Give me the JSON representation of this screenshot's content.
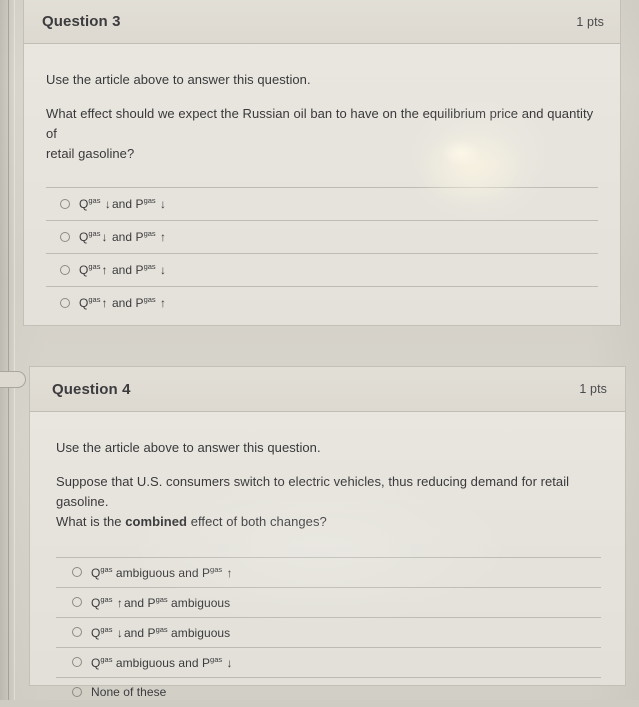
{
  "colors": {
    "page_bg": "#d6d3ca",
    "card_bg": "#e7e5dd",
    "header_bg": "#ddd9d1",
    "card_border": "#c3c0b7",
    "title_text": "#3c3c3f",
    "body_text": "#39393c",
    "divider": "#b0ada4"
  },
  "questions": [
    {
      "title": "Question 3",
      "points": "1 pts",
      "prompt_intro": "Use the article above to answer this question.",
      "prompt_line1": "What effect should we expect the Russian oil ban to have on the equilibrium price and quantity of",
      "prompt_line2": "retail gasoline?",
      "options": [
        {
          "q_symbol": "Q",
          "q_sup": "gas",
          "q_state": "↓",
          "conjunction": "and",
          "p_symbol": "P",
          "p_sup": "gas",
          "p_state": "↓"
        },
        {
          "q_symbol": "Q",
          "q_sup": "gas",
          "q_state": "↓",
          "conjunction": "and",
          "p_symbol": "P",
          "p_sup": "gas",
          "p_state": "↑"
        },
        {
          "q_symbol": "Q",
          "q_sup": "gas",
          "q_state": "↑",
          "conjunction": "and",
          "p_symbol": "P",
          "p_sup": "gas",
          "p_state": "↓"
        },
        {
          "q_symbol": "Q",
          "q_sup": "gas",
          "q_state": "↑",
          "conjunction": "and",
          "p_symbol": "P",
          "p_sup": "gas",
          "p_state": "↑"
        }
      ]
    },
    {
      "title": "Question 4",
      "points": "1 pts",
      "prompt_intro": "Use the article above to answer this question.",
      "prompt_line1_a": "Suppose that U.S. consumers switch to electric vehicles, thus reducing demand for retail gasoline.",
      "prompt_line2_a": "What is the ",
      "prompt_line2_bold": "combined",
      "prompt_line2_b": " effect of both changes?",
      "options": [
        {
          "q_symbol": "Q",
          "q_sup": "gas",
          "q_state": "ambiguous",
          "conjunction": "and",
          "p_symbol": "P",
          "p_sup": "gas",
          "p_state": "↑"
        },
        {
          "q_symbol": "Q",
          "q_sup": "gas",
          "q_state": "↑",
          "conjunction": "and",
          "p_symbol": "P",
          "p_sup": "gas",
          "p_state": "ambiguous"
        },
        {
          "q_symbol": "Q",
          "q_sup": "gas",
          "q_state": "↓",
          "conjunction": "and",
          "p_symbol": "P",
          "p_sup": "gas",
          "p_state": "ambiguous"
        },
        {
          "q_symbol": "Q",
          "q_sup": "gas",
          "q_state": "ambiguous",
          "conjunction": "and",
          "p_symbol": "P",
          "p_sup": "gas",
          "p_state": "↓"
        },
        {
          "plain": "None of these"
        }
      ]
    }
  ]
}
